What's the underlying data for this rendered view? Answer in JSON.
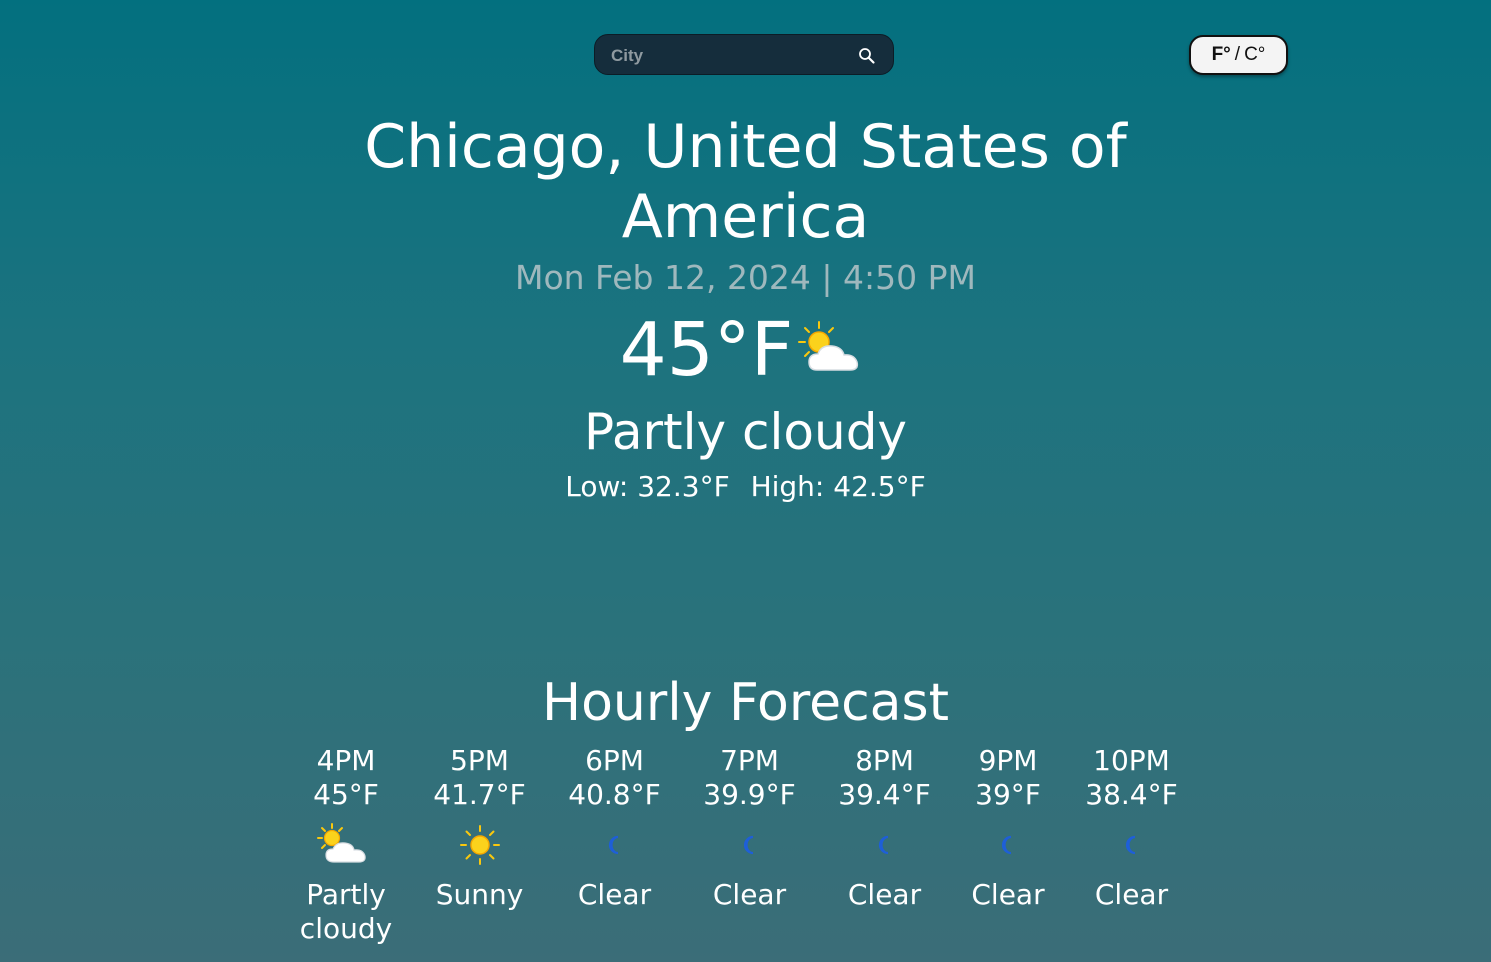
{
  "search": {
    "placeholder": "City",
    "value": ""
  },
  "unit_toggle": {
    "f_label": "F°",
    "separator": "/",
    "c_label": "C°",
    "active_unit": "F"
  },
  "location": {
    "title": "Chicago, United States of America"
  },
  "datetime": "Mon Feb 12, 2024 | 4:50 PM",
  "current": {
    "temp": "45°F",
    "icon": "partly-cloudy-icon",
    "condition": "Partly cloudy",
    "low": "Low: 32.3°F",
    "high": "High: 42.5°F"
  },
  "hourly": {
    "title": "Hourly Forecast",
    "items": [
      {
        "time": "4PM",
        "temp": "45°F",
        "icon": "partly-cloudy-icon",
        "condition": "Partly cloudy"
      },
      {
        "time": "5PM",
        "temp": "41.7°F",
        "icon": "sun-icon",
        "condition": "Sunny"
      },
      {
        "time": "6PM",
        "temp": "40.8°F",
        "icon": "moon-icon",
        "condition": "Clear"
      },
      {
        "time": "7PM",
        "temp": "39.9°F",
        "icon": "moon-icon",
        "condition": "Clear"
      },
      {
        "time": "8PM",
        "temp": "39.4°F",
        "icon": "moon-icon",
        "condition": "Clear"
      },
      {
        "time": "9PM",
        "temp": "39°F",
        "icon": "moon-icon",
        "condition": "Clear"
      },
      {
        "time": "10PM",
        "temp": "38.4°F",
        "icon": "moon-icon",
        "condition": "Clear"
      }
    ]
  },
  "colors": {
    "background_top": "#03707f",
    "background_bottom": "#3b6d78",
    "search_bg": "#152d3c",
    "datetime_text": "#9fb8bd",
    "sun": "#f9c80e",
    "moon": "#1e5fd8"
  }
}
